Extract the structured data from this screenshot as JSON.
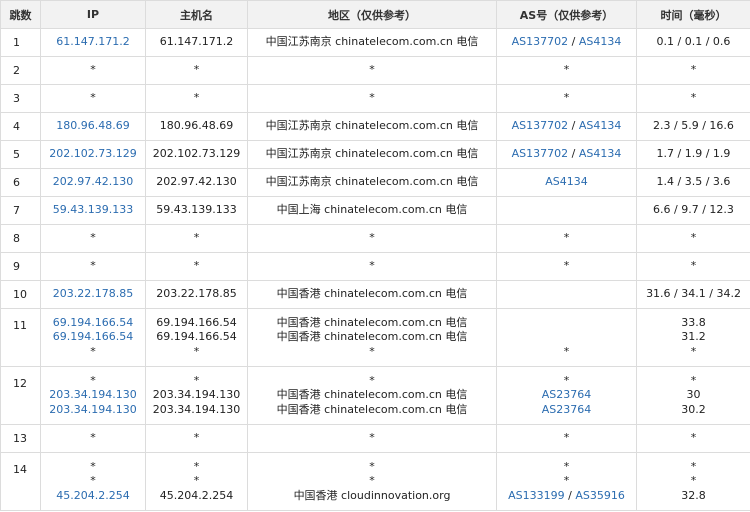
{
  "headers": [
    "跳数",
    "IP",
    "主机名",
    "地区（仅供参考）",
    "AS号（仅供参考）",
    "时间（毫秒）"
  ],
  "rows": [
    {
      "hop": "1",
      "ip": [
        "61.147.171.2"
      ],
      "host": [
        "61.147.171.2"
      ],
      "region": [
        "中国江苏南京 chinatelecom.com.cn 电信"
      ],
      "as": [
        [
          "AS137702",
          "AS4134"
        ]
      ],
      "time": [
        "0.1 / 0.1 / 0.6"
      ]
    },
    {
      "hop": "2",
      "ip": [
        "*"
      ],
      "host": [
        "*"
      ],
      "region": [
        "*"
      ],
      "as": [
        [
          "*"
        ]
      ],
      "time": [
        "*"
      ]
    },
    {
      "hop": "3",
      "ip": [
        "*"
      ],
      "host": [
        "*"
      ],
      "region": [
        "*"
      ],
      "as": [
        [
          "*"
        ]
      ],
      "time": [
        "*"
      ]
    },
    {
      "hop": "4",
      "ip": [
        "180.96.48.69"
      ],
      "host": [
        "180.96.48.69"
      ],
      "region": [
        "中国江苏南京 chinatelecom.com.cn 电信"
      ],
      "as": [
        [
          "AS137702",
          "AS4134"
        ]
      ],
      "time": [
        "2.3 / 5.9 / 16.6"
      ]
    },
    {
      "hop": "5",
      "ip": [
        "202.102.73.129"
      ],
      "host": [
        "202.102.73.129"
      ],
      "region": [
        "中国江苏南京 chinatelecom.com.cn 电信"
      ],
      "as": [
        [
          "AS137702",
          "AS4134"
        ]
      ],
      "time": [
        "1.7 / 1.9 / 1.9"
      ]
    },
    {
      "hop": "6",
      "ip": [
        "202.97.42.130"
      ],
      "host": [
        "202.97.42.130"
      ],
      "region": [
        "中国江苏南京 chinatelecom.com.cn 电信"
      ],
      "as": [
        [
          "AS4134"
        ]
      ],
      "time": [
        "1.4 / 3.5 / 3.6"
      ]
    },
    {
      "hop": "7",
      "ip": [
        "59.43.139.133"
      ],
      "host": [
        "59.43.139.133"
      ],
      "region": [
        "中国上海 chinatelecom.com.cn 电信"
      ],
      "as": [
        []
      ],
      "time": [
        "6.6 / 9.7 / 12.3"
      ]
    },
    {
      "hop": "8",
      "ip": [
        "*"
      ],
      "host": [
        "*"
      ],
      "region": [
        "*"
      ],
      "as": [
        [
          "*"
        ]
      ],
      "time": [
        "*"
      ]
    },
    {
      "hop": "9",
      "ip": [
        "*"
      ],
      "host": [
        "*"
      ],
      "region": [
        "*"
      ],
      "as": [
        [
          "*"
        ]
      ],
      "time": [
        "*"
      ]
    },
    {
      "hop": "10",
      "ip": [
        "203.22.178.85"
      ],
      "host": [
        "203.22.178.85"
      ],
      "region": [
        "中国香港 chinatelecom.com.cn 电信"
      ],
      "as": [
        []
      ],
      "time": [
        "31.6 / 34.1 / 34.2"
      ]
    },
    {
      "hop": "11",
      "ip": [
        "69.194.166.54",
        "69.194.166.54",
        "*"
      ],
      "host": [
        "69.194.166.54",
        "69.194.166.54",
        "*"
      ],
      "region": [
        "中国香港 chinatelecom.com.cn 电信",
        "中国香港 chinatelecom.com.cn 电信",
        "*"
      ],
      "as": [
        [],
        [],
        [
          "*"
        ]
      ],
      "time": [
        "33.8",
        "31.2",
        "*"
      ]
    },
    {
      "hop": "12",
      "ip": [
        "*",
        "203.34.194.130",
        "203.34.194.130"
      ],
      "host": [
        "*",
        "203.34.194.130",
        "203.34.194.130"
      ],
      "region": [
        "*",
        "中国香港 chinatelecom.com.cn 电信",
        "中国香港 chinatelecom.com.cn 电信"
      ],
      "as": [
        [
          "*"
        ],
        [
          "AS23764"
        ],
        [
          "AS23764"
        ]
      ],
      "time": [
        "*",
        "30",
        "30.2"
      ]
    },
    {
      "hop": "13",
      "ip": [
        "*"
      ],
      "host": [
        "*"
      ],
      "region": [
        "*"
      ],
      "as": [
        [
          "*"
        ]
      ],
      "time": [
        "*"
      ]
    },
    {
      "hop": "14",
      "ip": [
        "*",
        "*",
        "45.204.2.254"
      ],
      "host": [
        "*",
        "*",
        "45.204.2.254"
      ],
      "region": [
        "*",
        "*",
        "中国香港 cloudinnovation.org"
      ],
      "as": [
        [
          "*"
        ],
        [
          "*"
        ],
        [
          "AS133199",
          "AS35916"
        ]
      ],
      "time": [
        "*",
        "*",
        "32.8"
      ]
    }
  ]
}
